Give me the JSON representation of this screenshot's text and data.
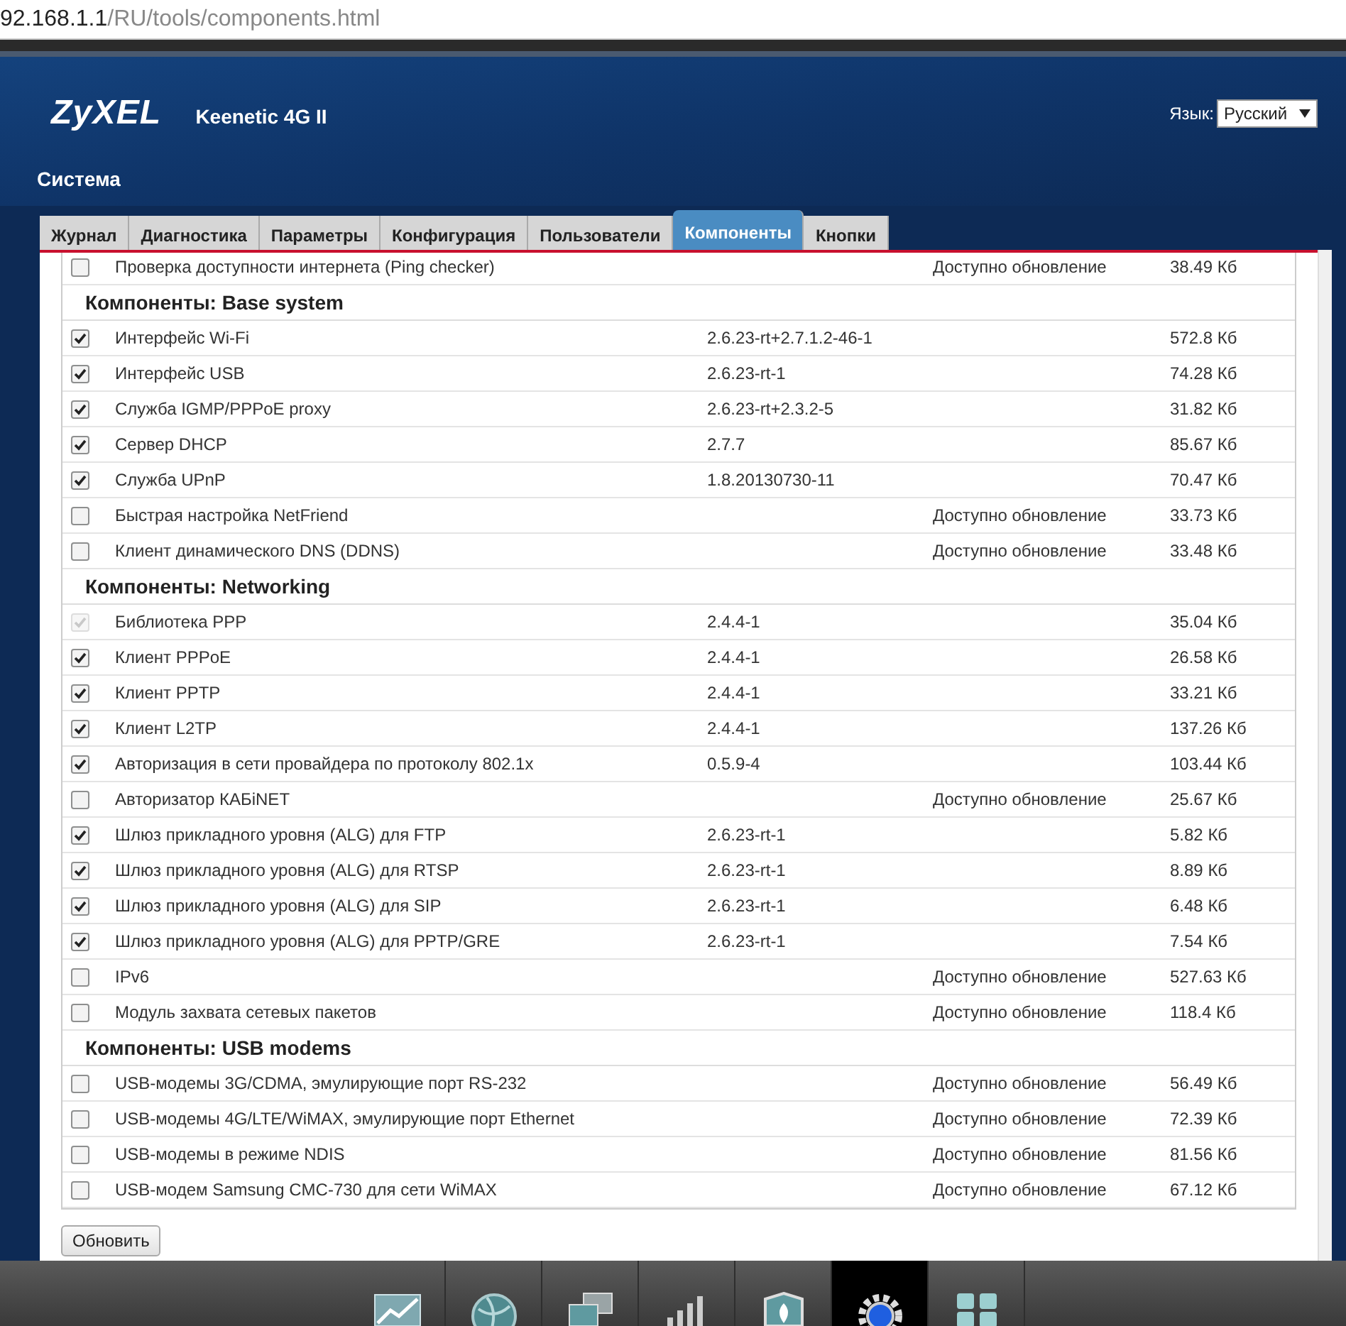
{
  "address_bar": {
    "host": "92.168.1.1",
    "path": "/RU/tools/components.html"
  },
  "header": {
    "logo": "ZyXEL",
    "model": "Keenetic 4G II",
    "language_label": "Язык:",
    "language_value": "Русский",
    "section_title": "Система"
  },
  "tabs": [
    {
      "label": "Журнал",
      "selected": false
    },
    {
      "label": "Диагностика",
      "selected": false
    },
    {
      "label": "Параметры",
      "selected": false
    },
    {
      "label": "Конфигурация",
      "selected": false
    },
    {
      "label": "Пользователи",
      "selected": false
    },
    {
      "label": "Компоненты",
      "selected": true
    },
    {
      "label": "Кнопки",
      "selected": false
    }
  ],
  "components": [
    {
      "kind": "component",
      "name": "Проверка доступности интернета (Ping checker)",
      "status": "Доступно обновление",
      "size": "38.49 Кб",
      "checked": false,
      "disabled": false
    },
    {
      "kind": "group",
      "title": "Компоненты: Base system"
    },
    {
      "kind": "component",
      "name": "Интерфейс Wi-Fi",
      "version": "2.6.23-rt+2.7.1.2-46-1",
      "size": "572.8 Кб",
      "checked": true,
      "disabled": false
    },
    {
      "kind": "component",
      "name": "Интерфейс USB",
      "version": "2.6.23-rt-1",
      "size": "74.28 Кб",
      "checked": true,
      "disabled": false
    },
    {
      "kind": "component",
      "name": "Служба IGMP/PPPoE proxy",
      "version": "2.6.23-rt+2.3.2-5",
      "size": "31.82 Кб",
      "checked": true,
      "disabled": false
    },
    {
      "kind": "component",
      "name": "Сервер DHCP",
      "version": "2.7.7",
      "size": "85.67 Кб",
      "checked": true,
      "disabled": false
    },
    {
      "kind": "component",
      "name": "Служба UPnP",
      "version": "1.8.20130730-11",
      "size": "70.47 Кб",
      "checked": true,
      "disabled": false
    },
    {
      "kind": "component",
      "name": "Быстрая настройка NetFriend",
      "status": "Доступно обновление",
      "size": "33.73 Кб",
      "checked": false,
      "disabled": false
    },
    {
      "kind": "component",
      "name": "Клиент динамического DNS (DDNS)",
      "status": "Доступно обновление",
      "size": "33.48 Кб",
      "checked": false,
      "disabled": false
    },
    {
      "kind": "group",
      "title": "Компоненты: Networking"
    },
    {
      "kind": "component",
      "name": "Библиотека PPP",
      "version": "2.4.4-1",
      "size": "35.04 Кб",
      "checked": true,
      "disabled": true
    },
    {
      "kind": "component",
      "name": "Клиент PPPoE",
      "version": "2.4.4-1",
      "size": "26.58 Кб",
      "checked": true,
      "disabled": false
    },
    {
      "kind": "component",
      "name": "Клиент PPTP",
      "version": "2.4.4-1",
      "size": "33.21 Кб",
      "checked": true,
      "disabled": false
    },
    {
      "kind": "component",
      "name": "Клиент L2TP",
      "version": "2.4.4-1",
      "size": "137.26 Кб",
      "checked": true,
      "disabled": false
    },
    {
      "kind": "component",
      "name": "Авторизация в сети провайдера по протоколу 802.1x",
      "version": "0.5.9-4",
      "size": "103.44 Кб",
      "checked": true,
      "disabled": false
    },
    {
      "kind": "component",
      "name": "Авторизатор КАБiNET",
      "status": "Доступно обновление",
      "size": "25.67 Кб",
      "checked": false,
      "disabled": false
    },
    {
      "kind": "component",
      "name": "Шлюз прикладного уровня (ALG) для FTP",
      "version": "2.6.23-rt-1",
      "size": "5.82 Кб",
      "checked": true,
      "disabled": false
    },
    {
      "kind": "component",
      "name": "Шлюз прикладного уровня (ALG) для RTSP",
      "version": "2.6.23-rt-1",
      "size": "8.89 Кб",
      "checked": true,
      "disabled": false
    },
    {
      "kind": "component",
      "name": "Шлюз прикладного уровня (ALG) для SIP",
      "version": "2.6.23-rt-1",
      "size": "6.48 Кб",
      "checked": true,
      "disabled": false
    },
    {
      "kind": "component",
      "name": "Шлюз прикладного уровня (ALG) для PPTP/GRE",
      "version": "2.6.23-rt-1",
      "size": "7.54 Кб",
      "checked": true,
      "disabled": false
    },
    {
      "kind": "component",
      "name": "IPv6",
      "status": "Доступно обновление",
      "size": "527.63 Кб",
      "checked": false,
      "disabled": false
    },
    {
      "kind": "component",
      "name": "Модуль захвата сетевых пакетов",
      "status": "Доступно обновление",
      "size": "118.4 Кб",
      "checked": false,
      "disabled": false
    },
    {
      "kind": "group",
      "title": "Компоненты: USB modems"
    },
    {
      "kind": "component",
      "name": "USB-модемы 3G/CDMA, эмулирующие порт RS-232",
      "status": "Доступно обновление",
      "size": "56.49 Кб",
      "checked": false,
      "disabled": false
    },
    {
      "kind": "component",
      "name": "USB-модемы 4G/LTE/WiMAX, эмулирующие порт Ethernet",
      "status": "Доступно обновление",
      "size": "72.39 Кб",
      "checked": false,
      "disabled": false
    },
    {
      "kind": "component",
      "name": "USB-модемы в режиме NDIS",
      "status": "Доступно обновление",
      "size": "81.56 Кб",
      "checked": false,
      "disabled": false
    },
    {
      "kind": "component",
      "name": "USB-модем Samsung CMC-730 для сети WiMAX",
      "status": "Доступно обновление",
      "size": "67.12 Кб",
      "checked": false,
      "disabled": false
    }
  ],
  "update_button": "Обновить",
  "taskbar": [
    {
      "kind": "chart",
      "selected": false
    },
    {
      "kind": "globe",
      "selected": false
    },
    {
      "kind": "computers",
      "selected": false
    },
    {
      "kind": "signal",
      "selected": false
    },
    {
      "kind": "shield",
      "selected": false
    },
    {
      "kind": "gear",
      "selected": true
    },
    {
      "kind": "grid",
      "selected": false
    }
  ]
}
